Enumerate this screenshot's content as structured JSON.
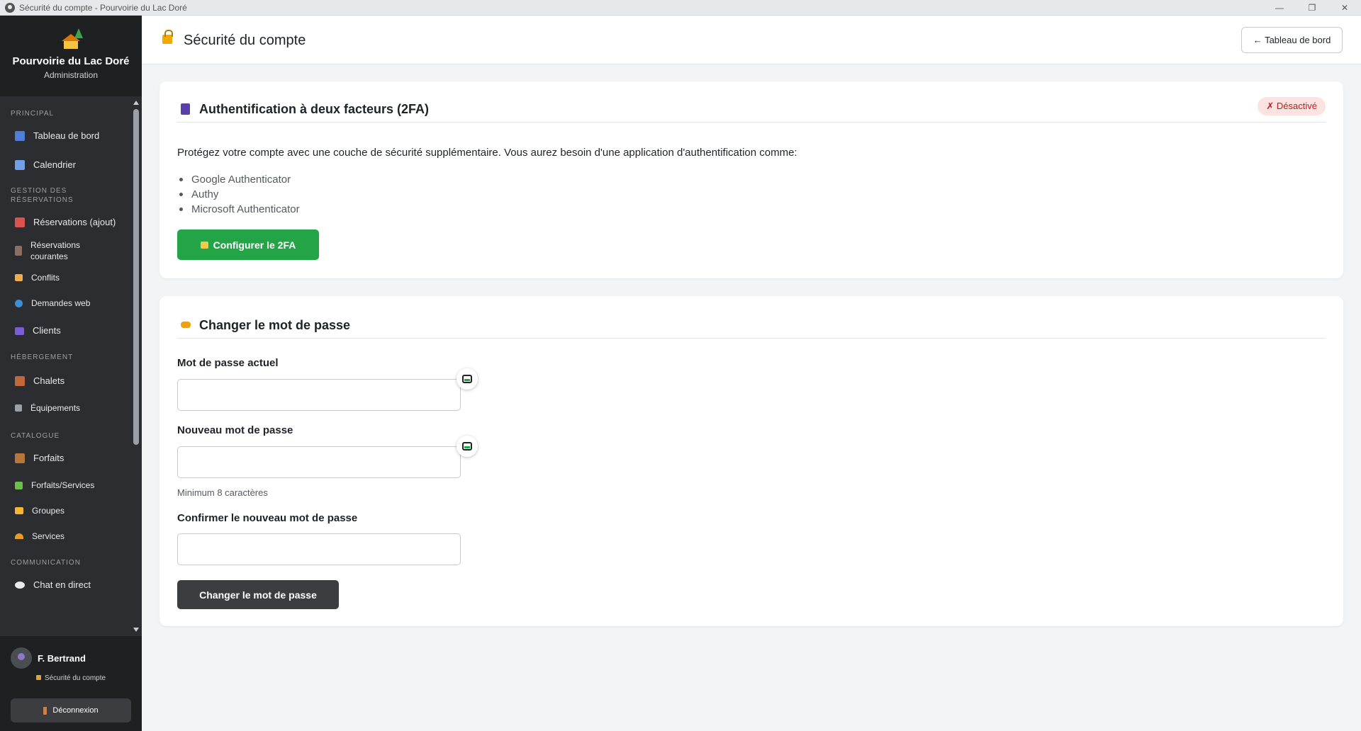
{
  "window": {
    "title": "Sécurité du compte - Pourvoirie du Lac Doré",
    "minimize": "—",
    "restore": "❐",
    "close": "✕"
  },
  "brand": {
    "name": "Pourvoirie du Lac Doré",
    "subtitle": "Administration"
  },
  "sidebar": {
    "sections": [
      {
        "title": "PRINCIPAL",
        "items": [
          {
            "label": "Tableau de bord",
            "icon": "bar-chart-icon",
            "color": "#4f7fd8"
          },
          {
            "label": "Calendrier",
            "icon": "calendar-icon",
            "color": "#6fa0e8"
          }
        ]
      },
      {
        "title": "GESTION DES RÉSERVATIONS",
        "items": [
          {
            "label": "Réservations (ajout)",
            "icon": "notepad-icon",
            "color": "#d9534f"
          },
          {
            "label": "Réservations courantes",
            "icon": "clipboard-icon",
            "color": "#8d6e63"
          },
          {
            "label": "Conflits",
            "icon": "warning-icon",
            "color": "#f0ad4e"
          },
          {
            "label": "Demandes web",
            "icon": "globe-icon",
            "color": "#3b8fd9"
          },
          {
            "label": "Clients",
            "icon": "people-icon",
            "color": "#7b5cd6"
          }
        ]
      },
      {
        "title": "HÉBERGEMENT",
        "items": [
          {
            "label": "Chalets",
            "icon": "cabin-icon",
            "color": "#c0683a"
          },
          {
            "label": "Équipements",
            "icon": "wrench-icon",
            "color": "#9aa0a6"
          }
        ]
      },
      {
        "title": "CATALOGUE",
        "items": [
          {
            "label": "Forfaits",
            "icon": "package-icon",
            "color": "#b5773b"
          },
          {
            "label": "Forfaits/Services",
            "icon": "puzzle-icon",
            "color": "#6cbf4a"
          },
          {
            "label": "Groupes",
            "icon": "folder-icon",
            "color": "#f2b632"
          },
          {
            "label": "Services",
            "icon": "bell-icon",
            "color": "#e89a2c"
          }
        ]
      },
      {
        "title": "COMMUNICATION",
        "items": [
          {
            "label": "Chat en direct",
            "icon": "chat-bubble-icon",
            "color": "#e9eaec"
          }
        ]
      }
    ]
  },
  "user": {
    "name": "F. Bertrand",
    "security_link": "Sécurité du compte",
    "logout_label": "Déconnexion"
  },
  "header": {
    "title": "Sécurité du compte",
    "back_label": "← Tableau de bord"
  },
  "twofa": {
    "title": "Authentification à deux facteurs (2FA)",
    "status": "✗ Désactivé",
    "description": "Protégez votre compte avec une couche de sécurité supplémentaire. Vous aurez besoin d'une application d'authentification comme:",
    "apps": [
      "Google Authenticator",
      "Authy",
      "Microsoft Authenticator"
    ],
    "button_label": "Configurer le 2FA"
  },
  "password": {
    "title": "Changer le mot de passe",
    "current_label": "Mot de passe actuel",
    "current_value": "",
    "new_label": "Nouveau mot de passe",
    "new_value": "",
    "new_hint": "Minimum 8 caractères",
    "confirm_label": "Confirmer le nouveau mot de passe",
    "confirm_value": "",
    "button_label": "Changer le mot de passe"
  }
}
